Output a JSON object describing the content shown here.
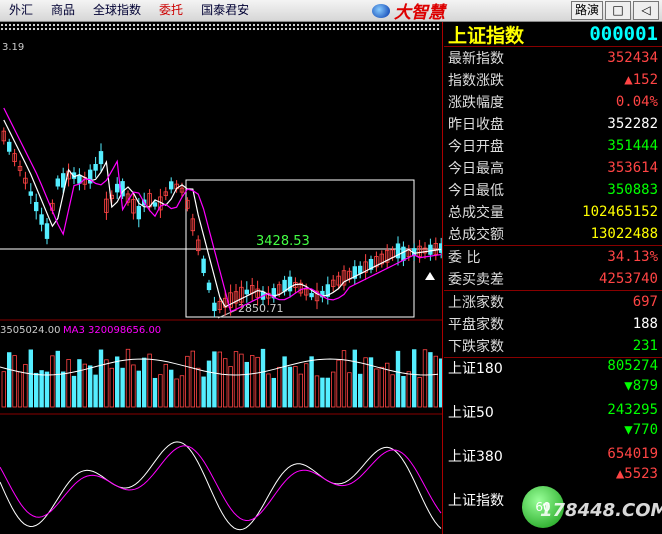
{
  "menu": [
    "外汇",
    "商品",
    "全球指数",
    "委托",
    "国泰君安"
  ],
  "menu_active": 3,
  "logo_text": "大智慧",
  "top_buttons": {
    "b1": "路演",
    "b2": "□",
    "b3": "◁"
  },
  "chart": {
    "yaxis_top_label": "3.19",
    "hline_label": "3428.53",
    "low_label": "2850.71",
    "vol_label": "3505024.00",
    "ma3_label": "MA3  320098656.00"
  },
  "quote": {
    "name": "上证指数",
    "code": "000001",
    "rows": [
      {
        "label": "最新指数",
        "value": "352434",
        "color": "red"
      },
      {
        "label": "指数涨跌",
        "value": "▲152",
        "color": "red"
      },
      {
        "label": "涨跌幅度",
        "value": "0.04%",
        "color": "red"
      },
      {
        "label": "昨日收盘",
        "value": "352282",
        "color": "white"
      },
      {
        "label": "今日开盘",
        "value": "351444",
        "color": "green"
      },
      {
        "label": "今日最高",
        "value": "353614",
        "color": "red"
      },
      {
        "label": "今日最低",
        "value": "350883",
        "color": "green"
      },
      {
        "label": "总成交量",
        "value": "102465152",
        "color": "yellow"
      },
      {
        "label": "总成交额",
        "value": "13022488",
        "color": "yellow"
      },
      {
        "label": "委    比",
        "value": "34.13%",
        "color": "red"
      },
      {
        "label": "委买卖差",
        "value": "4253740",
        "color": "red"
      },
      {
        "label": "上涨家数",
        "value": "697",
        "color": "red"
      },
      {
        "label": "平盘家数",
        "value": "188",
        "color": "white"
      },
      {
        "label": "下跌家数",
        "value": "231",
        "color": "green"
      }
    ],
    "indices": [
      {
        "name": "上证180",
        "value": "805274",
        "change": "▼879",
        "value_color": "green",
        "change_color": "green"
      },
      {
        "name": "上证50",
        "value": "243295",
        "change": "▼770",
        "value_color": "green",
        "change_color": "green"
      },
      {
        "name": "上证380",
        "value": "654019",
        "change": "▲5523",
        "value_color": "red",
        "change_color": "red"
      },
      {
        "name": "上证指数",
        "value": "",
        "change": "",
        "value_color": "red",
        "change_color": "red"
      }
    ]
  },
  "badge_text": "60",
  "watermark": "178448.COM"
}
